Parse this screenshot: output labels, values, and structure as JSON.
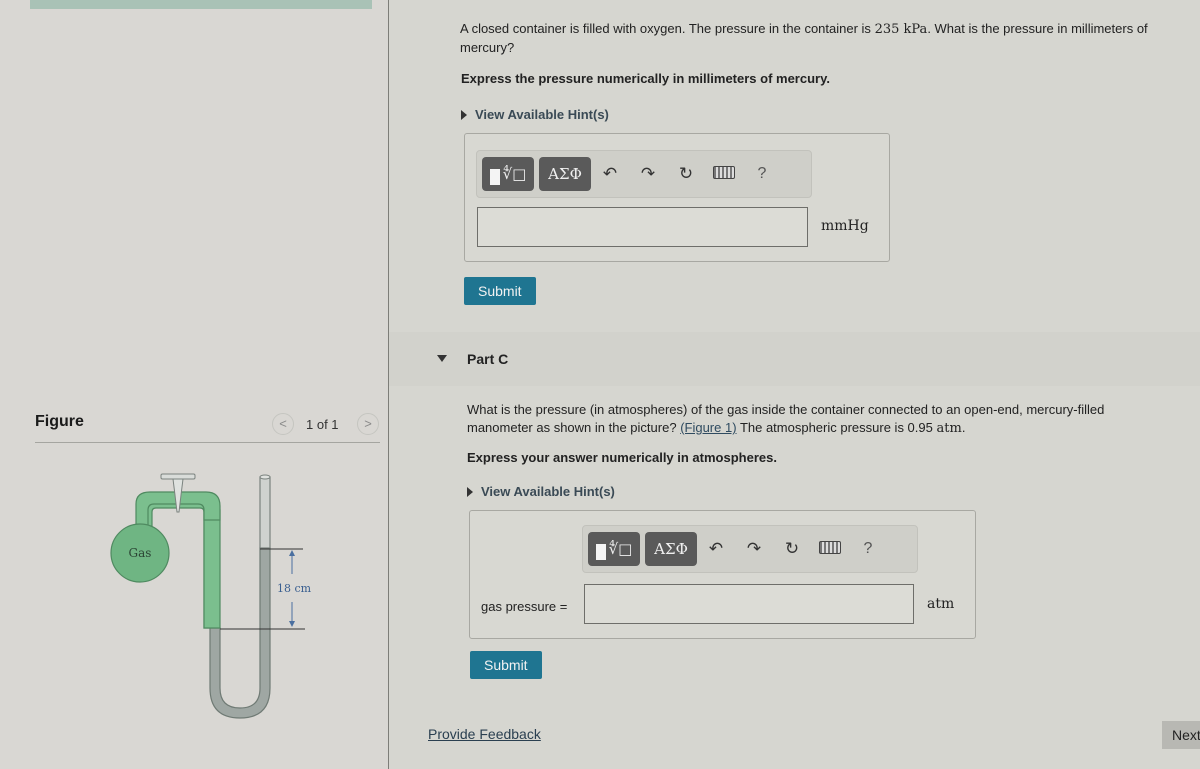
{
  "figure_panel": {
    "title": "Figure",
    "pager": {
      "prev_label": "<",
      "next_label": ">",
      "count": "1 of 1"
    },
    "diagram": {
      "gas_label": "Gas",
      "height_label": "18 cm"
    }
  },
  "part_b": {
    "question": "A closed container is filled with oxygen. The pressure in the container is",
    "pressure_value": "235 kPa",
    "question_end": ". What is the pressure in millimeters of mercury?",
    "instruction": "Express the pressure numerically in millimeters of mercury.",
    "hint_label": "View Available Hint(s)",
    "toolbar": {
      "templates_icon": "templates-icon",
      "greek_label": "ΑΣΦ",
      "undo_icon": "undo-icon",
      "redo_icon": "redo-icon",
      "reset_icon": "reset-icon",
      "keyboard_icon": "keyboard-icon",
      "help_label": "?"
    },
    "answer_value": "",
    "unit": "mmHg",
    "submit_label": "Submit"
  },
  "part_c": {
    "title": "Part C",
    "question_line1": "What is the pressure (in atmospheres) of the gas inside the container connected to an open-end, mercury-filled",
    "question_line2_pre": "manometer as shown in the picture?",
    "figure_link": "(Figure 1)",
    "question_line2_post": "The atmospheric pressure is 0.95",
    "atm_unit_inline": "atm",
    "instruction": "Express your answer numerically in atmospheres.",
    "hint_label": "View Available Hint(s)",
    "toolbar": {
      "greek_label": "ΑΣΦ",
      "help_label": "?"
    },
    "answer_label": "gas pressure =",
    "answer_value": "",
    "unit": "atm",
    "submit_label": "Submit"
  },
  "footer": {
    "feedback_label": "Provide Feedback",
    "next_label": "Next"
  }
}
